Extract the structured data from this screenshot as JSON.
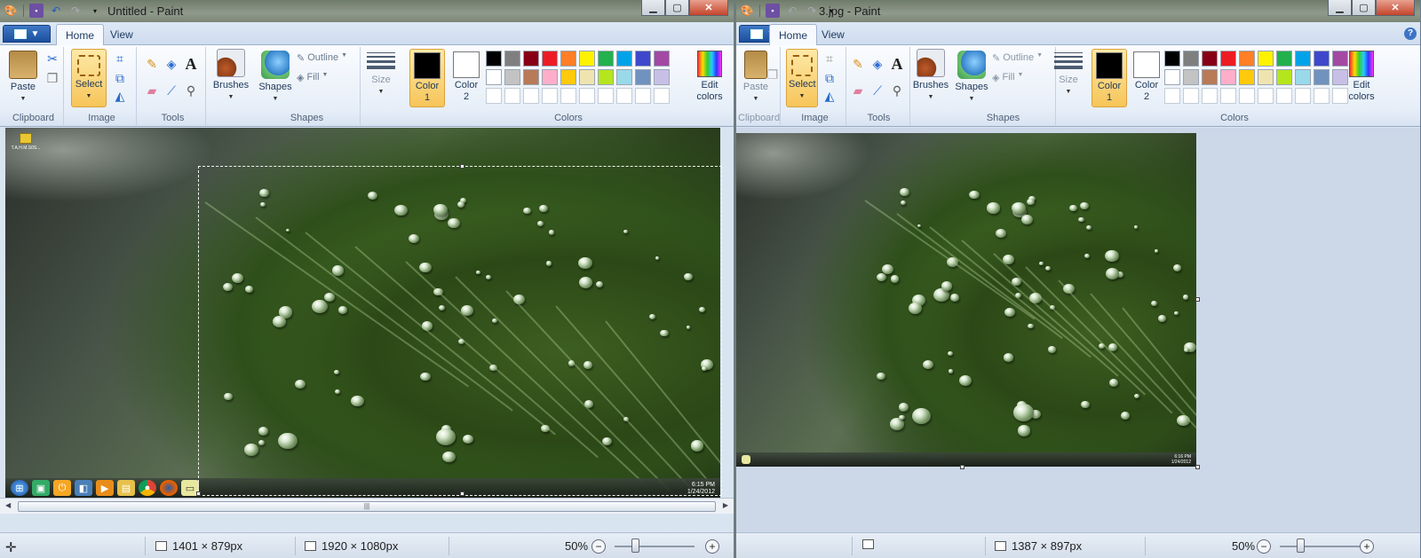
{
  "windows": [
    {
      "id": "left",
      "title": "Untitled - Paint",
      "tabs": [
        "Home",
        "View"
      ],
      "status": {
        "selection_size": "1401 × 879px",
        "image_size": "1920 × 1080px",
        "zoom": "50%"
      },
      "desktop_icon_label": "T.A.H.M.S0S...",
      "tray_time": "6:15 PM",
      "tray_date": "1/24/2012"
    },
    {
      "id": "right",
      "title": "3.jpg - Paint",
      "tabs": [
        "Home",
        "View"
      ],
      "status": {
        "selection_size": "",
        "image_size": "1387 × 897px",
        "zoom": "50%"
      },
      "tray_time": "6:16 PM",
      "tray_date": "1/24/2012"
    }
  ],
  "ribbon": {
    "paste": "Paste",
    "select": "Select",
    "brushes": "Brushes",
    "shapes": "Shapes",
    "outline": "Outline",
    "fill": "Fill",
    "size": "Size",
    "color1": [
      "Color",
      "1"
    ],
    "color2": [
      "Color",
      "2"
    ],
    "edit_colors": [
      "Edit",
      "colors"
    ],
    "groups": {
      "clipboard": "Clipboard",
      "image": "Image",
      "tools": "Tools",
      "shapes": "Shapes",
      "colors": "Colors"
    },
    "text_tool": "A",
    "help": "?"
  },
  "palette": {
    "row1": [
      "#000000",
      "#7f7f7f",
      "#880015",
      "#ed1c24",
      "#ff7f27",
      "#fff200",
      "#22b14c",
      "#00a2e8",
      "#3f48cc",
      "#a349a4"
    ],
    "row2": [
      "#ffffff",
      "#c3c3c3",
      "#b97a57",
      "#ffaec9",
      "#ffc90e",
      "#efe4b0",
      "#b5e61d",
      "#99d9ea",
      "#7092be",
      "#c8bfe7"
    ],
    "row3": [
      "#ffffff",
      "#ffffff",
      "#ffffff",
      "#ffffff",
      "#ffffff",
      "#ffffff",
      "#ffffff",
      "#ffffff",
      "#ffffff",
      "#ffffff"
    ]
  },
  "colors": {
    "color1": "#000000",
    "color2": "#ffffff",
    "accent": "#f7c55a"
  },
  "scroll_thumb": "|||"
}
